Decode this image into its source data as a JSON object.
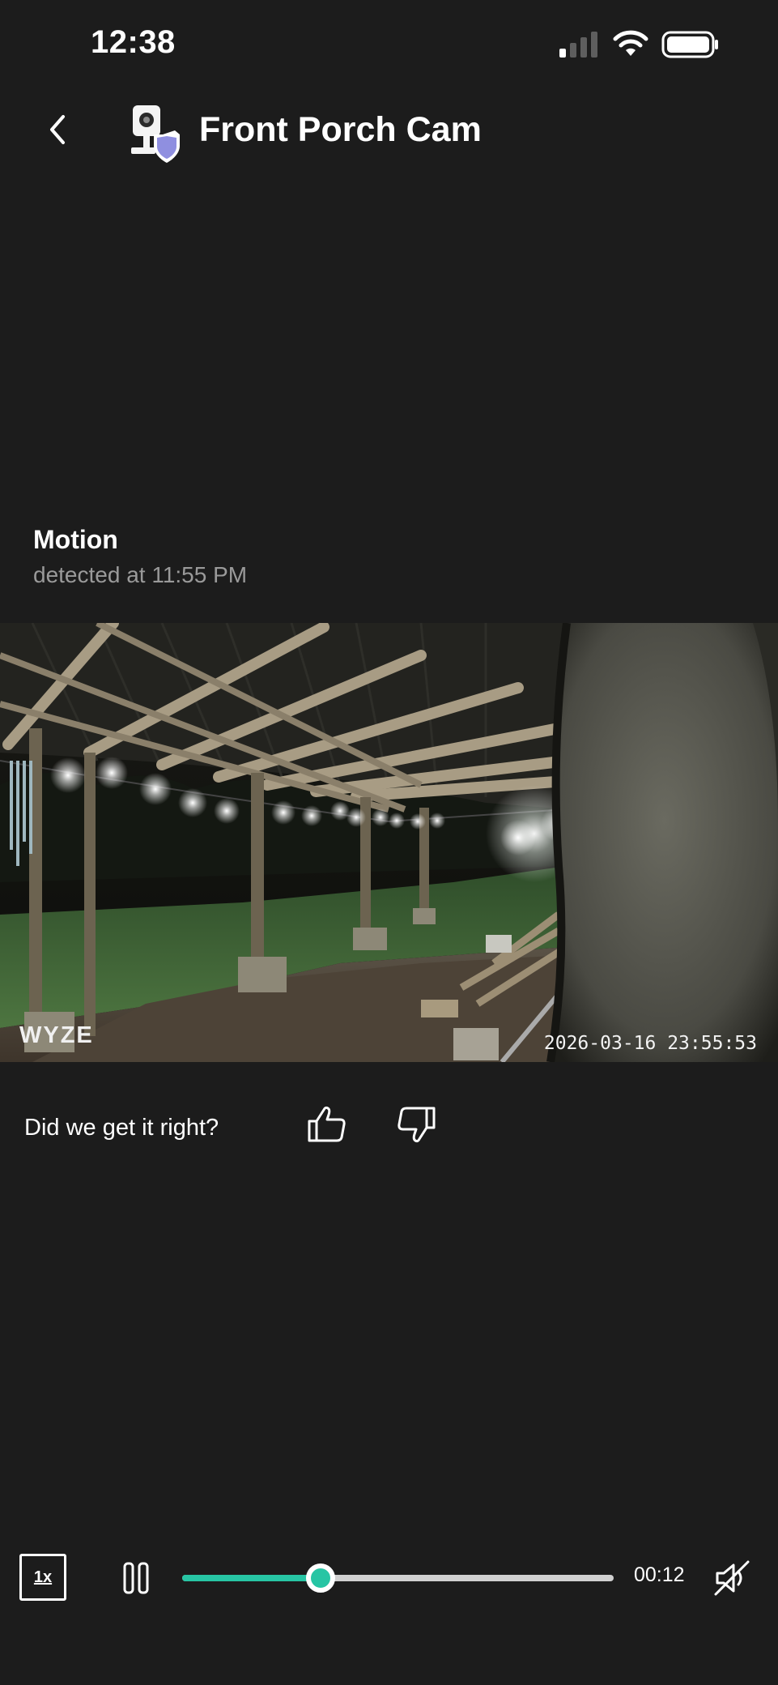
{
  "status_bar": {
    "time": "12:38",
    "icons": [
      "signal-icon",
      "wifi-icon",
      "battery-icon"
    ]
  },
  "header": {
    "title": "Front Porch Cam",
    "back_icon": "chevron-left-icon",
    "device_icon": "security-camera-icon"
  },
  "event": {
    "type": "Motion",
    "detected": "detected at 11:55 PM"
  },
  "video": {
    "watermark": "WYZE",
    "timestamp": "2026-03-16 23:55:53"
  },
  "feedback": {
    "question": "Did we get it right?",
    "icons": [
      "thumbs-up-icon",
      "thumbs-down-icon"
    ]
  },
  "playback": {
    "speed": "1x",
    "elapsed": "00:12",
    "progress": 0.32,
    "accent_color": "#27c5a4",
    "icons": [
      "pause-icon",
      "mute-icon"
    ]
  }
}
